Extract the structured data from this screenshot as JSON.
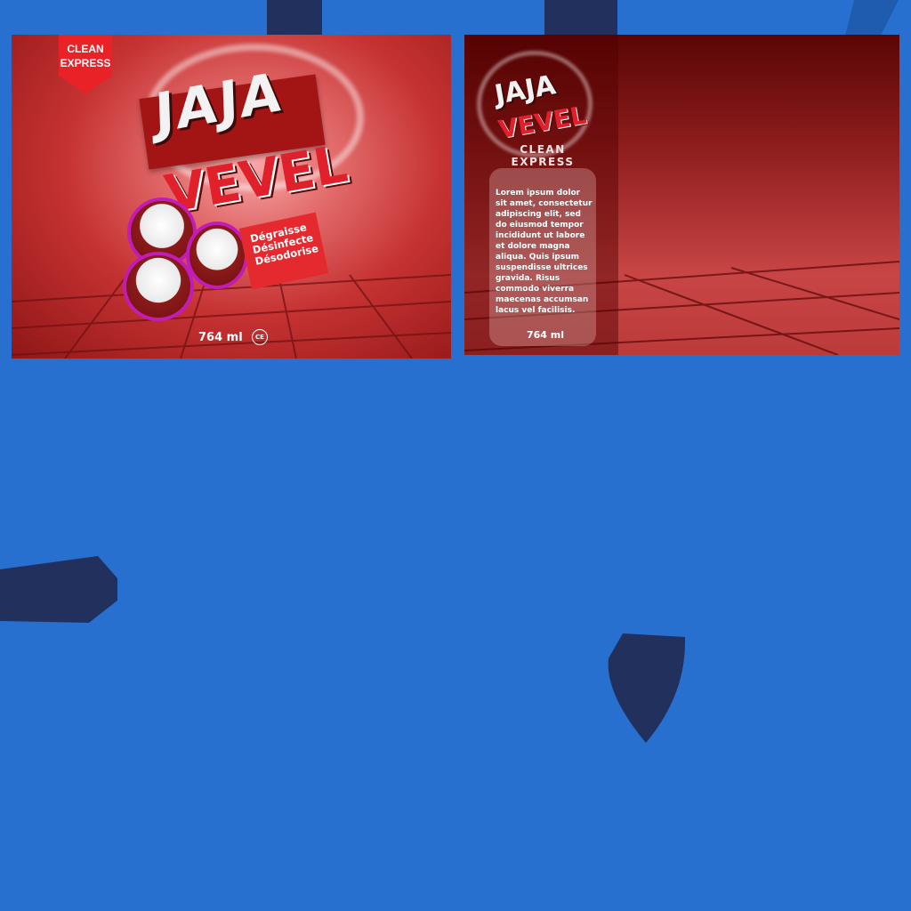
{
  "front_label": {
    "ribbon_text": "CLEAN\nEXPRESS",
    "brand_line1": "JAJA",
    "brand_line2": "VEVEL",
    "claims": "Dégraisse\nDésinfecte\nDésodorise",
    "volume": "764 ml",
    "ce_mark": "CE"
  },
  "back_label": {
    "brand_line1": "JAJA",
    "brand_line2": "VEVEL",
    "brand_tagline": "CLEAN\nEXPRESS",
    "description": "Lorem ipsum dolor sit amet, consectetur adipiscing elit, sed do eiusmod tempor incididunt ut labore et dolore magna aliqua. Quis ipsum suspendisse ultrices gravida. Risus commodo viverra maecenas accumsan lacus vel facilisis.",
    "volume": "764 ml"
  },
  "colors": {
    "background": "#2770d0",
    "dark_shape": "#22305e",
    "brand_red": "#e0202a",
    "accent_magenta": "#c21cb8"
  }
}
